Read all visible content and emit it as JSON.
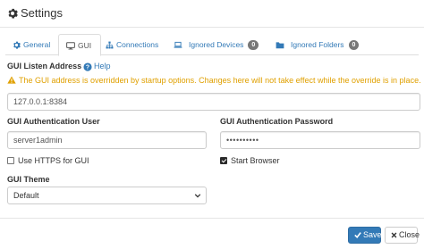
{
  "header": {
    "title": "Settings"
  },
  "tabs": [
    {
      "label": "General",
      "icon": "gear-icon"
    },
    {
      "label": "GUI",
      "icon": "monitor-icon"
    },
    {
      "label": "Connections",
      "icon": "sitemap-icon"
    },
    {
      "label": "Ignored Devices",
      "icon": "laptop-icon",
      "badge": "0"
    },
    {
      "label": "Ignored Folders",
      "icon": "folder-icon",
      "badge": "0"
    }
  ],
  "gui": {
    "listen_label": "GUI Listen Address",
    "help_label": "Help",
    "warning": "The GUI address is overridden by startup options. Changes here will not take effect while the override is in place.",
    "listen_value": "127.0.0.1:8384",
    "user_label": "GUI Authentication User",
    "user_value": "server1admin",
    "password_label": "GUI Authentication Password",
    "password_value": "••••••••••",
    "https_label": "Use HTTPS for GUI",
    "https_checked": false,
    "browser_label": "Start Browser",
    "browser_checked": true,
    "theme_label": "GUI Theme",
    "theme_value": "Default"
  },
  "footer": {
    "save_label": "Save",
    "close_label": "Close"
  },
  "colors": {
    "link": "#337ab7",
    "warning": "#e0a000",
    "primary": "#337ab7",
    "badge": "#777777"
  }
}
